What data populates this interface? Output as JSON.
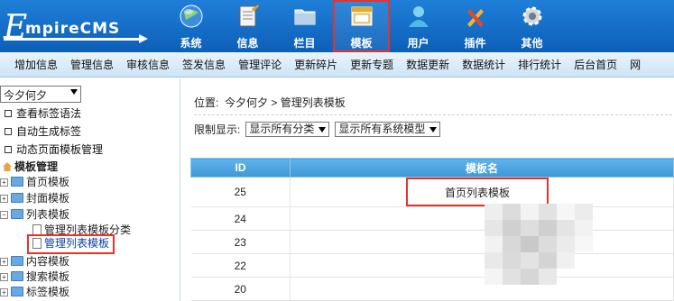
{
  "logo": {
    "big_letter": "E",
    "text": "mpireCMS"
  },
  "nav": [
    {
      "label": "系统",
      "icon": "globe-icon"
    },
    {
      "label": "信息",
      "icon": "notepad-icon"
    },
    {
      "label": "栏目",
      "icon": "folder-icon"
    },
    {
      "label": "模板",
      "icon": "template-window-icon",
      "active": true
    },
    {
      "label": "用户",
      "icon": "user-icon"
    },
    {
      "label": "插件",
      "icon": "tools-icon"
    },
    {
      "label": "其他",
      "icon": "gear-icon"
    }
  ],
  "menubar": [
    "增加信息",
    "管理信息",
    "审核信息",
    "签发信息",
    "管理评论",
    "更新碎片",
    "更新专题",
    "数据更新",
    "数据统计",
    "排行统计",
    "后台首页",
    "网"
  ],
  "sidebar": {
    "select_value": "今夕何夕",
    "links": [
      "查看标签语法",
      "自动生成标签",
      "动态页面模板管理"
    ],
    "tree_root": "模板管理",
    "tree": [
      "首页模板",
      "封面模板",
      "列表模板"
    ],
    "list_children": [
      "管理列表模板分类",
      "管理列表模板"
    ],
    "tree_after": [
      "内容模板",
      "搜索模板",
      "标签模板"
    ]
  },
  "main": {
    "breadcrumb_prefix": "位置:",
    "breadcrumb_site": "今夕何夕",
    "breadcrumb_sep": ">",
    "breadcrumb_page": "管理列表模板",
    "filter_label": "限制显示:",
    "filter_class": "显示所有分类",
    "filter_model": "显示所有系统模型",
    "col_id": "ID",
    "col_name": "模板名",
    "rows": [
      {
        "id": "25",
        "name": "首页列表模板"
      },
      {
        "id": "24",
        "name": ""
      },
      {
        "id": "23",
        "name": ""
      },
      {
        "id": "22",
        "name": ""
      },
      {
        "id": "20",
        "name": ""
      }
    ]
  },
  "colors": {
    "topbar": "#1a72cc",
    "highlight": "#e8322e",
    "table_header": "#4ea6e0"
  }
}
